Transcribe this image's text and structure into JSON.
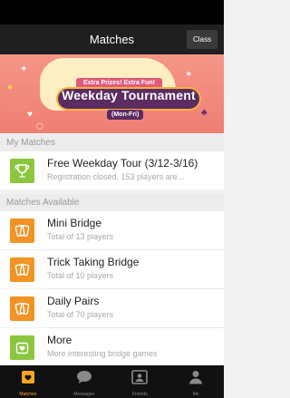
{
  "header": {
    "title": "Matches",
    "class_button": "Class"
  },
  "banner": {
    "subtitle": "Extra Prizes! Extra Fun!",
    "title": "Weekday Tournament",
    "days": "(Mon-Fri)"
  },
  "my_matches": {
    "section_label": "My Matches",
    "items": [
      {
        "title": "Free Weekday Tour (3/12-3/16)",
        "subtitle": "Registration closed. 153 players are...",
        "icon": "trophy-icon",
        "color": "#8cc63e"
      }
    ]
  },
  "available": {
    "section_label": "Matches Available",
    "items": [
      {
        "title": "Mini Bridge",
        "subtitle": "Total of 13 players",
        "icon": "cards-icon",
        "color": "#f39325"
      },
      {
        "title": "Trick Taking Bridge",
        "subtitle": "Total of 10 players",
        "icon": "cards-icon",
        "color": "#f39325"
      },
      {
        "title": "Daily Pairs",
        "subtitle": "Total of 70 players",
        "icon": "cards-icon",
        "color": "#f39325"
      },
      {
        "title": "More",
        "subtitle": "More interesting bridge games",
        "icon": "more-games-icon",
        "color": "#8cc63e"
      }
    ]
  },
  "tabbar": {
    "items": [
      {
        "label": "Matches",
        "icon": "matches-icon",
        "active": true
      },
      {
        "label": "Messages",
        "icon": "chat-bubble-icon",
        "active": false
      },
      {
        "label": "Friends",
        "icon": "contacts-icon",
        "active": false
      },
      {
        "label": "Me",
        "icon": "person-icon",
        "active": false
      }
    ]
  },
  "colors": {
    "accent": "#f6a623",
    "green": "#8cc63e",
    "orange": "#f39325",
    "banner": "#ef7e73"
  }
}
